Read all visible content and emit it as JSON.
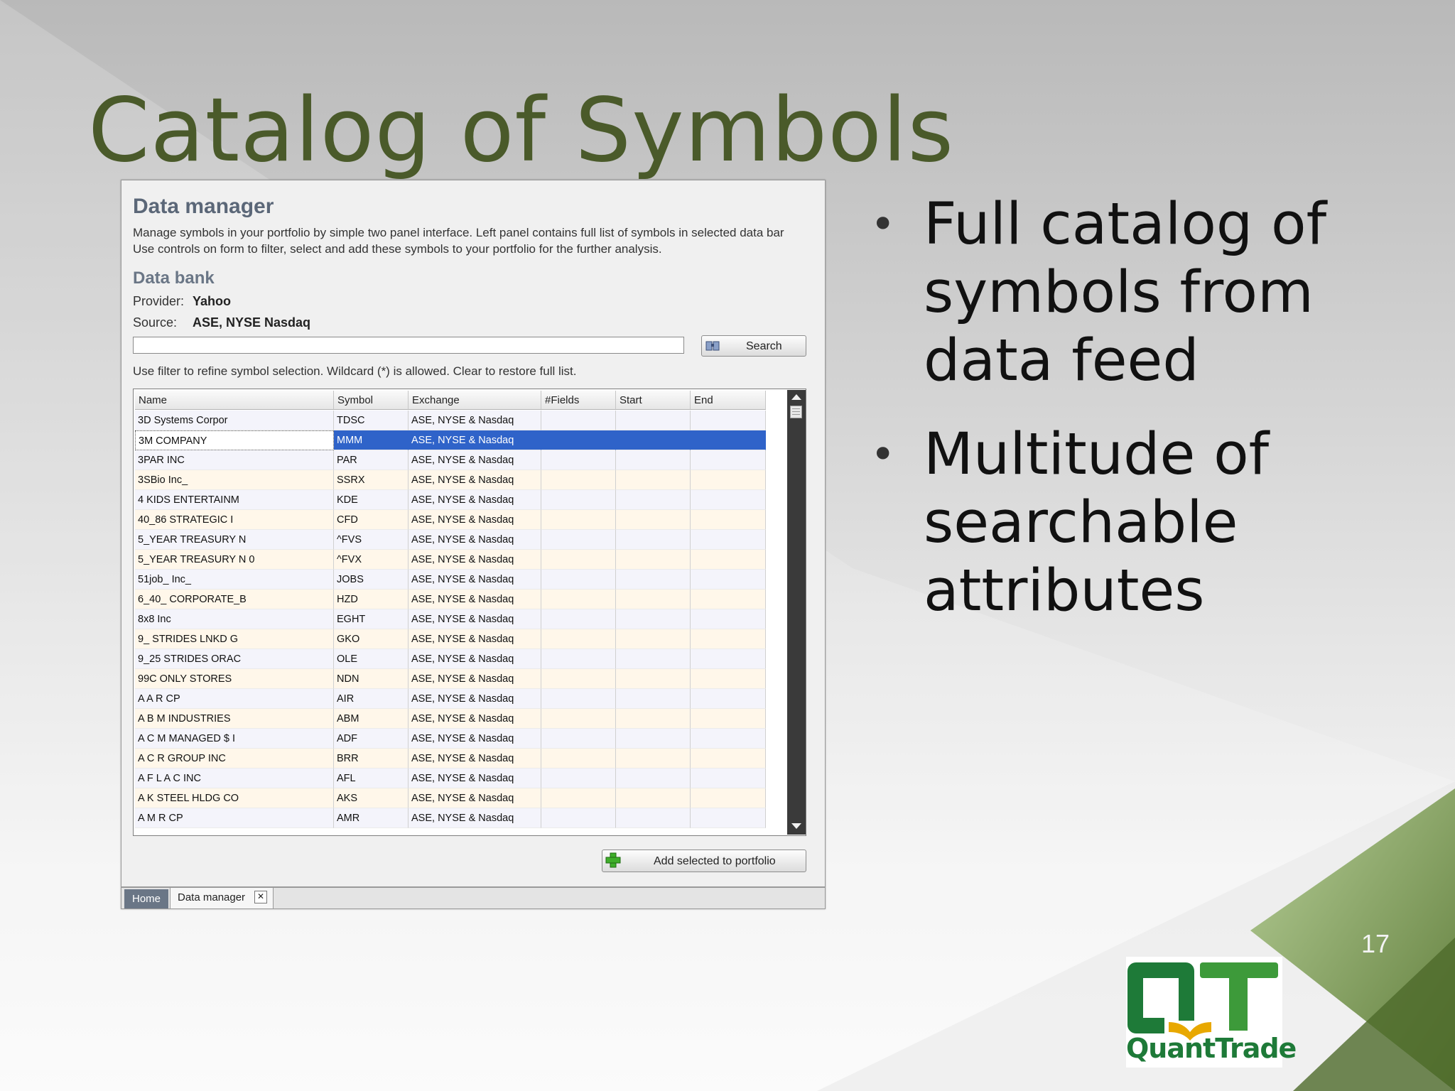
{
  "slide": {
    "title": "Catalog of Symbols",
    "bullets": [
      "Full catalog of symbols from data feed",
      "Multitude of searchable attributes"
    ],
    "page_number": "17",
    "logo_text": "QuantTrade"
  },
  "data_manager": {
    "heading": "Data manager",
    "description_line1": "Manage symbols in your portfolio by simple two panel interface. Left panel contains full list of symbols in selected data bar",
    "description_line2": "Use controls on form to filter, select and add these symbols to your portfolio for the further analysis.",
    "data_bank_heading": "Data bank",
    "provider_label": "Provider:",
    "provider_value": "Yahoo",
    "source_label": "Source:",
    "source_value": "ASE, NYSE Nasdaq",
    "filter_value": "",
    "search_label": "Search",
    "hint": "Use filter to refine symbol selection. Wildcard (*) is allowed. Clear to restore full list.",
    "add_button_label": "Add selected to portfolio"
  },
  "grid": {
    "columns": [
      "Name",
      "Symbol",
      "Exchange",
      "#Fields",
      "Start",
      "End"
    ],
    "selected_index": 1,
    "rows": [
      {
        "name": "3D Systems Corpor",
        "symbol": "TDSC",
        "exchange": "ASE, NYSE & Nasdaq"
      },
      {
        "name": "3M COMPANY",
        "symbol": "MMM",
        "exchange": "ASE, NYSE & Nasdaq"
      },
      {
        "name": "3PAR INC",
        "symbol": "PAR",
        "exchange": "ASE, NYSE & Nasdaq"
      },
      {
        "name": "3SBio Inc_",
        "symbol": "SSRX",
        "exchange": "ASE, NYSE & Nasdaq"
      },
      {
        "name": "4 KIDS ENTERTAINM",
        "symbol": "KDE",
        "exchange": "ASE, NYSE & Nasdaq"
      },
      {
        "name": "40_86 STRATEGIC I",
        "symbol": "CFD",
        "exchange": "ASE, NYSE & Nasdaq"
      },
      {
        "name": "5_YEAR TREASURY N",
        "symbol": "^FVS",
        "exchange": "ASE, NYSE & Nasdaq"
      },
      {
        "name": "5_YEAR TREASURY N 0",
        "symbol": "^FVX",
        "exchange": "ASE, NYSE & Nasdaq"
      },
      {
        "name": "51job_ Inc_",
        "symbol": "JOBS",
        "exchange": "ASE, NYSE & Nasdaq"
      },
      {
        "name": "6_40_ CORPORATE_B",
        "symbol": "HZD",
        "exchange": "ASE, NYSE & Nasdaq"
      },
      {
        "name": "8x8 Inc",
        "symbol": "EGHT",
        "exchange": "ASE, NYSE & Nasdaq"
      },
      {
        "name": "9_ STRIDES LNKD G",
        "symbol": "GKO",
        "exchange": "ASE, NYSE & Nasdaq"
      },
      {
        "name": "9_25 STRIDES ORAC",
        "symbol": "OLE",
        "exchange": "ASE, NYSE & Nasdaq"
      },
      {
        "name": "99C ONLY STORES",
        "symbol": "NDN",
        "exchange": "ASE, NYSE & Nasdaq"
      },
      {
        "name": "A A R CP",
        "symbol": "AIR",
        "exchange": "ASE, NYSE & Nasdaq"
      },
      {
        "name": "A B M INDUSTRIES",
        "symbol": "ABM",
        "exchange": "ASE, NYSE & Nasdaq"
      },
      {
        "name": "A C M MANAGED $ I",
        "symbol": "ADF",
        "exchange": "ASE, NYSE & Nasdaq"
      },
      {
        "name": "A C R GROUP INC",
        "symbol": "BRR",
        "exchange": "ASE, NYSE & Nasdaq"
      },
      {
        "name": "A F L A C INC",
        "symbol": "AFL",
        "exchange": "ASE, NYSE & Nasdaq"
      },
      {
        "name": "A K STEEL HLDG CO",
        "symbol": "AKS",
        "exchange": "ASE, NYSE & Nasdaq"
      },
      {
        "name": "A M R CP",
        "symbol": "AMR",
        "exchange": "ASE, NYSE & Nasdaq"
      }
    ]
  },
  "tabs": {
    "home": "Home",
    "data_manager": "Data manager",
    "close_glyph": "✕"
  },
  "colors": {
    "title": "#4a5a2a",
    "selection": "#2f63c9",
    "accent_green": "#7d9b55",
    "logo_green": "#1e7a38",
    "logo_yellow": "#e8a800"
  }
}
